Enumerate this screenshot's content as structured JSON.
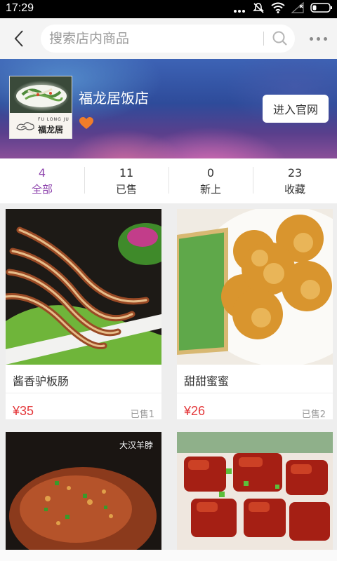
{
  "status_bar": {
    "time": "17:29"
  },
  "search": {
    "placeholder": "搜索店内商品"
  },
  "shop": {
    "name": "福龙居饭店",
    "logo_text_en": "FU LONG JU",
    "logo_text_cn": "福龙居",
    "enter_label": "进入官网"
  },
  "stats": [
    {
      "count": "4",
      "label": "全部"
    },
    {
      "count": "11",
      "label": "已售"
    },
    {
      "count": "0",
      "label": "新上"
    },
    {
      "count": "23",
      "label": "收藏"
    }
  ],
  "products": [
    {
      "name": "酱香驴板肠",
      "price": "¥35",
      "sold": "已售1"
    },
    {
      "name": "甜甜蜜蜜",
      "price": "¥26",
      "sold": "已售2"
    },
    {
      "caption": "大汉羊脖"
    },
    {
      "caption": ""
    }
  ],
  "colors": {
    "accent": "#8e44ad",
    "price": "#e4393c",
    "heart": "#f07d2a"
  }
}
